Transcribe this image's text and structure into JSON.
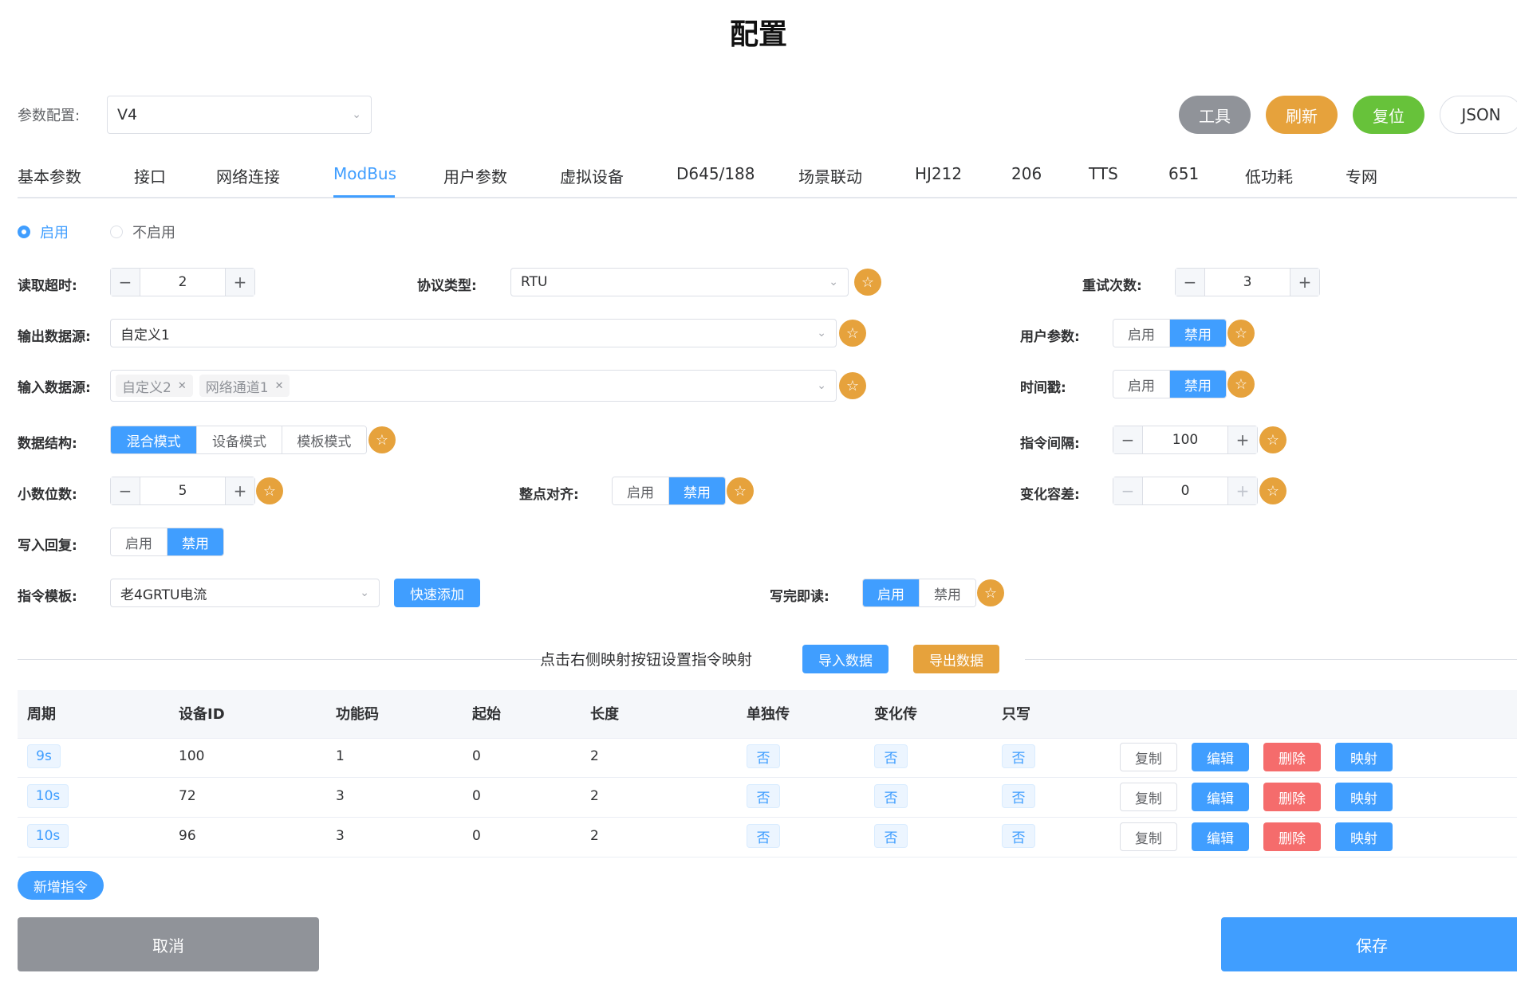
{
  "page": {
    "title": "配置"
  },
  "config": {
    "label": "参数配置:",
    "value": "V4"
  },
  "header_buttons": {
    "tools": "工具",
    "refresh": "刷新",
    "reset": "复位",
    "json": "JSON"
  },
  "tabs": [
    {
      "label": "基本参数"
    },
    {
      "label": "接口"
    },
    {
      "label": "网络连接"
    },
    {
      "label": "ModBus"
    },
    {
      "label": "用户参数"
    },
    {
      "label": "虚拟设备"
    },
    {
      "label": "D645/188"
    },
    {
      "label": "场景联动"
    },
    {
      "label": "HJ212"
    },
    {
      "label": "206"
    },
    {
      "label": "TTS"
    },
    {
      "label": "651"
    },
    {
      "label": "低功耗"
    },
    {
      "label": "专网"
    }
  ],
  "active_tab": "ModBus",
  "enable": {
    "on": "启用",
    "off": "不启用"
  },
  "form": {
    "read_timeout": {
      "label": "读取超时:",
      "value": "2"
    },
    "protocol": {
      "label": "协议类型:",
      "value": "RTU"
    },
    "retry": {
      "label": "重试次数:",
      "value": "3"
    },
    "output_source": {
      "label": "输出数据源:",
      "value": "自定义1"
    },
    "user_params": {
      "label": "用户参数:",
      "on": "启用",
      "off": "禁用"
    },
    "input_source": {
      "label": "输入数据源:",
      "tags": [
        "自定义2",
        "网络通道1"
      ]
    },
    "timestamp": {
      "label": "时间戳:",
      "on": "启用",
      "off": "禁用"
    },
    "data_structure": {
      "label": "数据结构:",
      "options": [
        "混合模式",
        "设备模式",
        "模板模式"
      ]
    },
    "cmd_interval": {
      "label": "指令间隔:",
      "value": "100"
    },
    "decimals": {
      "label": "小数位数:",
      "value": "5"
    },
    "align": {
      "label": "整点对齐:",
      "on": "启用",
      "off": "禁用"
    },
    "change_tol": {
      "label": "变化容差:",
      "value": "0"
    },
    "write_reply": {
      "label": "写入回复:",
      "on": "启用",
      "off": "禁用"
    },
    "cmd_template": {
      "label": "指令模板:",
      "value": "老4GRTU电流",
      "quick_add": "快速添加"
    },
    "read_after_write": {
      "label": "写完即读:",
      "on": "启用",
      "off": "禁用"
    }
  },
  "mapping": {
    "hint": "点击右侧映射按钮设置指令映射",
    "import": "导入数据",
    "export": "导出数据"
  },
  "table": {
    "headers": [
      "周期",
      "设备ID",
      "功能码",
      "起始",
      "长度",
      "单独传",
      "变化传",
      "只写"
    ],
    "rows": [
      {
        "period": "9s",
        "device": "100",
        "func": "1",
        "start": "0",
        "len": "2",
        "single": "否",
        "change": "否",
        "wo": "否"
      },
      {
        "period": "10s",
        "device": "72",
        "func": "3",
        "start": "0",
        "len": "2",
        "single": "否",
        "change": "否",
        "wo": "否"
      },
      {
        "period": "10s",
        "device": "96",
        "func": "3",
        "start": "0",
        "len": "2",
        "single": "否",
        "change": "否",
        "wo": "否"
      }
    ],
    "actions": {
      "copy": "复制",
      "edit": "编辑",
      "delete": "删除",
      "map": "映射"
    }
  },
  "add_cmd": "新增指令",
  "footer": {
    "cancel": "取消",
    "save": "保存"
  },
  "colors": {
    "primary": "#409eff",
    "warning": "#e6a23c",
    "success": "#67c23a",
    "danger": "#f56c6c",
    "info": "#909399"
  },
  "icons": {
    "star": "star-icon",
    "chevron": "chevron-down-icon",
    "minus": "minus-icon",
    "plus": "plus-icon",
    "close": "close-icon"
  }
}
